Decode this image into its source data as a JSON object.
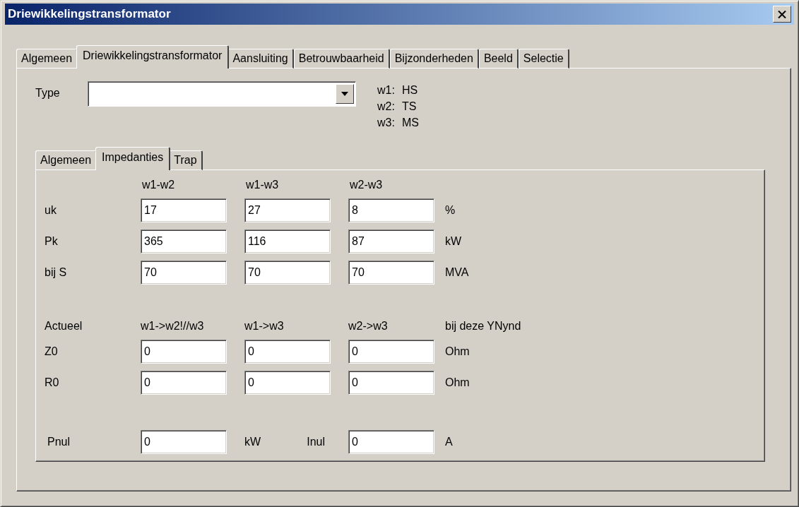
{
  "window": {
    "title": "Driewikkelingstransformator"
  },
  "tabs": [
    {
      "label": "Algemeen",
      "selected": false
    },
    {
      "label": "Driewikkelingstransformator",
      "selected": true
    },
    {
      "label": "Aansluiting",
      "selected": false
    },
    {
      "label": "Betrouwbaarheid",
      "selected": false
    },
    {
      "label": "Bijzonderheden",
      "selected": false
    },
    {
      "label": "Beeld",
      "selected": false
    },
    {
      "label": "Selectie",
      "selected": false
    }
  ],
  "type_field": {
    "label": "Type"
  },
  "windings": [
    {
      "name": "w1:",
      "value": "HS"
    },
    {
      "name": "w2:",
      "value": "TS"
    },
    {
      "name": "w3:",
      "value": "MS"
    }
  ],
  "sub_tabs": [
    {
      "label": "Algemeen",
      "selected": false
    },
    {
      "label": "Impedanties",
      "selected": true
    },
    {
      "label": "Trap",
      "selected": false
    }
  ],
  "impedances": {
    "columns": [
      "w1-w2",
      "w1-w3",
      "w2-w3"
    ],
    "rows": [
      {
        "label": "uk",
        "values": [
          "17",
          "27",
          "8"
        ],
        "unit": "%"
      },
      {
        "label": "Pk",
        "values": [
          "365",
          "116",
          "87"
        ],
        "unit": "kW"
      },
      {
        "label": "bij S",
        "values": [
          "70",
          "70",
          "70"
        ],
        "unit": "MVA"
      }
    ]
  },
  "zero_sequence": {
    "label": "Actueel",
    "columns": [
      "w1->w2!//w3",
      "w1->w3",
      "w2->w3"
    ],
    "note": "bij deze YNynd",
    "rows": [
      {
        "label": "Z0",
        "values": [
          "0",
          "0",
          "0"
        ],
        "unit": "Ohm"
      },
      {
        "label": "R0",
        "values": [
          "0",
          "0",
          "0"
        ],
        "unit": "Ohm"
      }
    ]
  },
  "no_load": [
    {
      "label": "Pnul",
      "value": "0",
      "unit": "kW"
    },
    {
      "label": "Inul",
      "value": "0",
      "unit": "A"
    }
  ]
}
